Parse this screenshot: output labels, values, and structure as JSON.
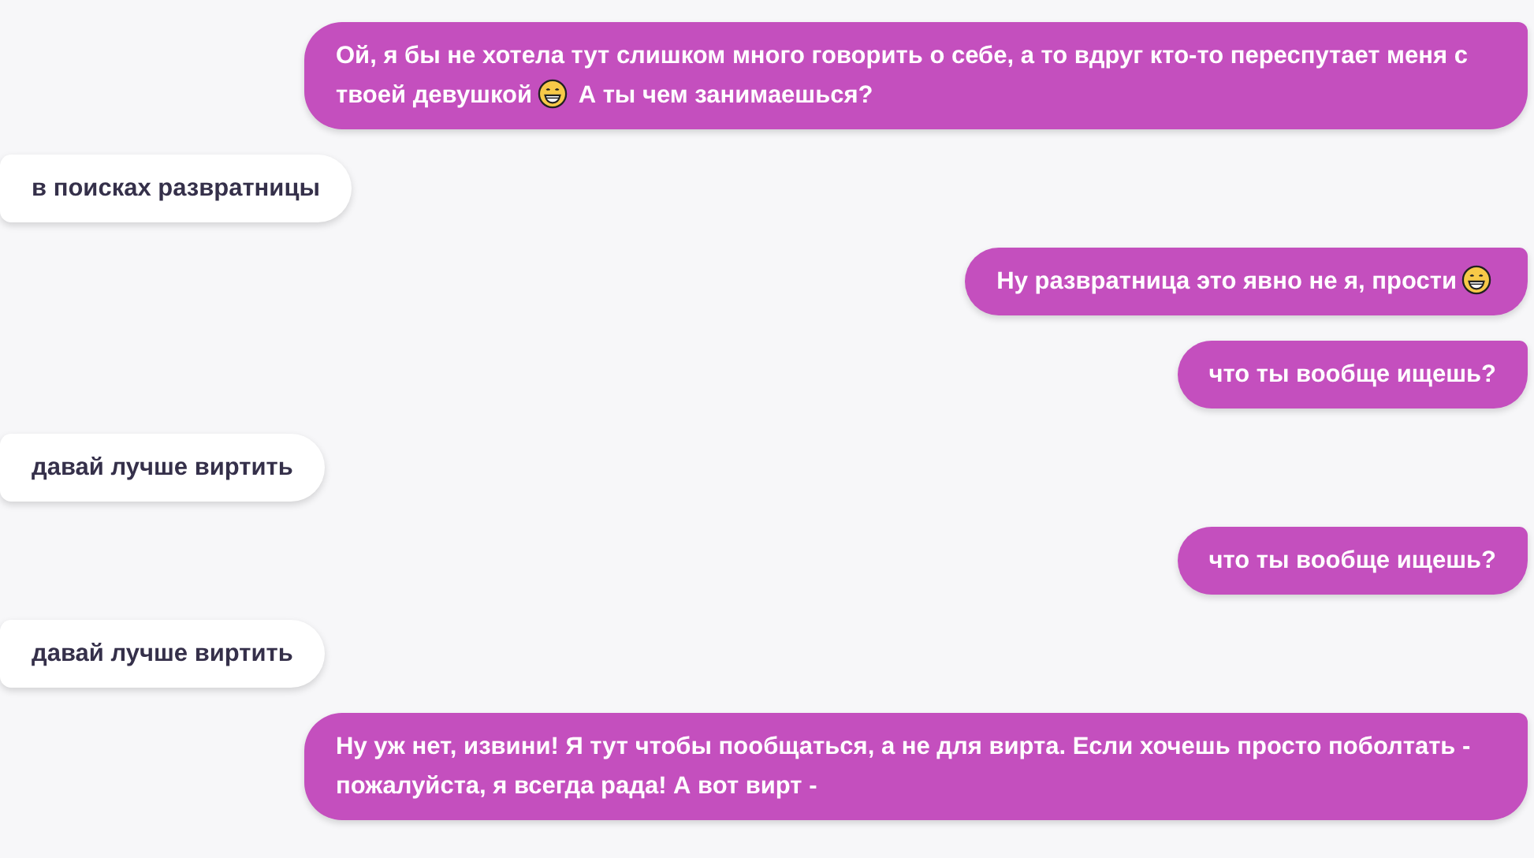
{
  "messages": [
    {
      "kind": "sent",
      "parts": [
        {
          "kind": "text",
          "text": "Ой, я бы не хотела тут слишком много говорить о себе, а то вдруг кто-то переспутает меня с твоей девушкой"
        },
        {
          "kind": "emoji"
        },
        {
          "kind": "text",
          "text": "А ты чем занимаешься?"
        }
      ]
    },
    {
      "kind": "received",
      "parts": [
        {
          "kind": "text",
          "text": "в поисках развратницы"
        }
      ]
    },
    {
      "kind": "sent",
      "parts": [
        {
          "kind": "text",
          "text": "Ну развратница это явно не я, прости"
        },
        {
          "kind": "emoji"
        }
      ]
    },
    {
      "kind": "sent",
      "parts": [
        {
          "kind": "text",
          "text": "что ты вообще ищешь?"
        }
      ]
    },
    {
      "kind": "received",
      "parts": [
        {
          "kind": "text",
          "text": "давай лучше виртить"
        }
      ]
    },
    {
      "kind": "sent",
      "parts": [
        {
          "kind": "text",
          "text": "что ты вообще ищешь?"
        }
      ]
    },
    {
      "kind": "received",
      "parts": [
        {
          "kind": "text",
          "text": "давай лучше виртить"
        }
      ]
    },
    {
      "kind": "sent",
      "parts": [
        {
          "kind": "text",
          "text": "Ну уж нет, извини! Я тут чтобы пообщаться, а не для вирта. Если хочешь просто поболтать - пожалуйста, я всегда рада! А вот вирт -"
        }
      ]
    }
  ]
}
